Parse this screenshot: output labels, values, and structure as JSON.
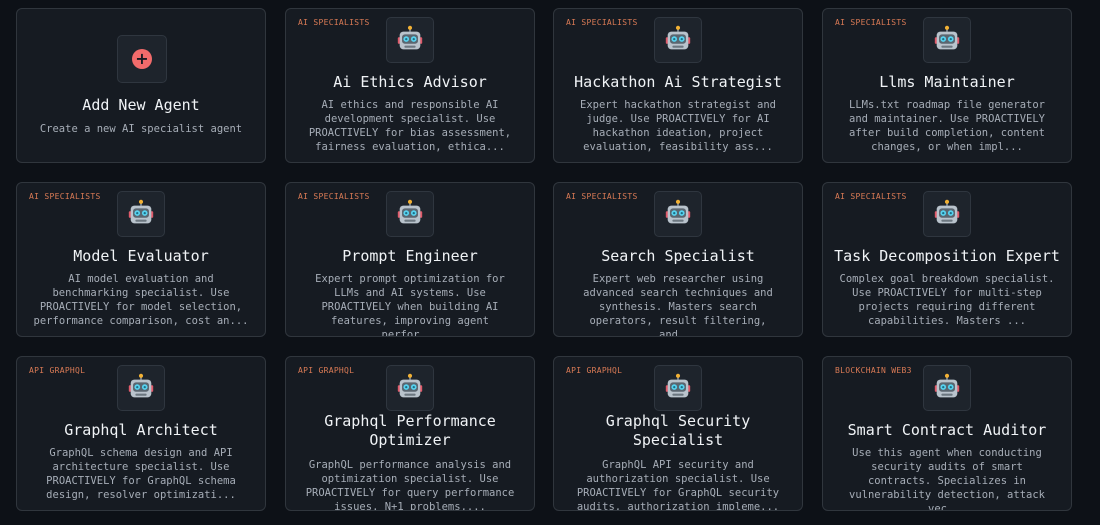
{
  "add_card": {
    "title": "Add New Agent",
    "description": "Create a new AI specialist agent",
    "icon": "plus-icon",
    "accent": "#f26b6b"
  },
  "category_color": "#d97a55",
  "agents": [
    {
      "category": "AI SPECIALISTS",
      "name": "Ai Ethics Advisor",
      "description": "AI ethics and responsible AI development specialist. Use PROACTIVELY for bias assessment, fairness evaluation, ethica...",
      "icon": "robot-icon"
    },
    {
      "category": "AI SPECIALISTS",
      "name": "Hackathon Ai Strategist",
      "description": "Expert hackathon strategist and judge. Use PROACTIVELY for AI hackathon ideation, project evaluation, feasibility ass...",
      "icon": "robot-icon"
    },
    {
      "category": "AI SPECIALISTS",
      "name": "Llms Maintainer",
      "description": "LLMs.txt roadmap file generator and maintainer. Use PROACTIVELY after build completion, content changes, or when impl...",
      "icon": "robot-icon"
    },
    {
      "category": "AI SPECIALISTS",
      "name": "Model Evaluator",
      "description": "AI model evaluation and benchmarking specialist. Use PROACTIVELY for model selection, performance comparison, cost an...",
      "icon": "robot-icon"
    },
    {
      "category": "AI SPECIALISTS",
      "name": "Prompt Engineer",
      "description": "Expert prompt optimization for LLMs and AI systems. Use PROACTIVELY when building AI features, improving agent perfor...",
      "icon": "robot-icon"
    },
    {
      "category": "AI SPECIALISTS",
      "name": "Search Specialist",
      "description": "Expert web researcher using advanced search techniques and synthesis. Masters search operators, result filtering, and...",
      "icon": "robot-icon"
    },
    {
      "category": "AI SPECIALISTS",
      "name": "Task Decomposition Expert",
      "description": "Complex goal breakdown specialist. Use PROACTIVELY for multi-step projects requiring different capabilities. Masters ...",
      "icon": "robot-icon"
    },
    {
      "category": "API GRAPHQL",
      "name": "Graphql Architect",
      "description": "GraphQL schema design and API architecture specialist. Use PROACTIVELY for GraphQL schema design, resolver optimizati...",
      "icon": "robot-icon"
    },
    {
      "category": "API GRAPHQL",
      "name": "Graphql Performance Optimizer",
      "description": "GraphQL performance analysis and optimization specialist. Use PROACTIVELY for query performance issues, N+1 problems,...",
      "icon": "robot-icon"
    },
    {
      "category": "API GRAPHQL",
      "name": "Graphql Security Specialist",
      "description": "GraphQL API security and authorization specialist. Use PROACTIVELY for GraphQL security audits, authorization impleme...",
      "icon": "robot-icon"
    },
    {
      "category": "BLOCKCHAIN WEB3",
      "name": "Smart Contract Auditor",
      "description": "Use this agent when conducting security audits of smart contracts. Specializes in vulnerability detection, attack vec...",
      "icon": "robot-icon"
    }
  ]
}
